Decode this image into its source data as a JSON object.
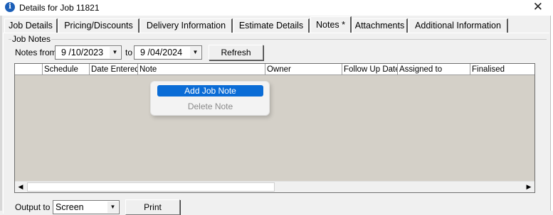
{
  "window": {
    "title": "Details for Job 11821",
    "close_glyph": "✕"
  },
  "tabs": [
    {
      "label": "Job Details"
    },
    {
      "label": "Pricing/Discounts"
    },
    {
      "label": "Delivery Information"
    },
    {
      "label": "Estimate Details"
    },
    {
      "label": "Notes *",
      "active": true
    },
    {
      "label": "Attachments"
    },
    {
      "label": "Additional Information"
    }
  ],
  "job_notes": {
    "group_label": "Job Notes",
    "notes_from_label": "Notes from",
    "from_date": "9 /10/2023",
    "to_label": "to",
    "to_date": "9 /04/2024",
    "refresh_label": "Refresh"
  },
  "grid": {
    "columns": [
      "",
      "Schedule",
      "Date Entered",
      "Note",
      "Owner",
      "Follow Up Date",
      "Assigned to",
      "Finalised"
    ],
    "rows": []
  },
  "context_menu": {
    "items": [
      {
        "label": "Add Job Note",
        "highlighted": true,
        "enabled": true
      },
      {
        "label": "Delete Note",
        "highlighted": false,
        "enabled": false
      }
    ]
  },
  "output": {
    "label": "Output to",
    "value": "Screen",
    "print_label": "Print"
  },
  "icons": {
    "window_icon": "info-icon",
    "left_arrow": "◀",
    "right_arrow": "▶",
    "dropdown": "▼"
  },
  "colors": {
    "highlight": "#0a6cd6",
    "grid_bg": "#d4d0c8",
    "window_bg": "#f0f0f0"
  }
}
